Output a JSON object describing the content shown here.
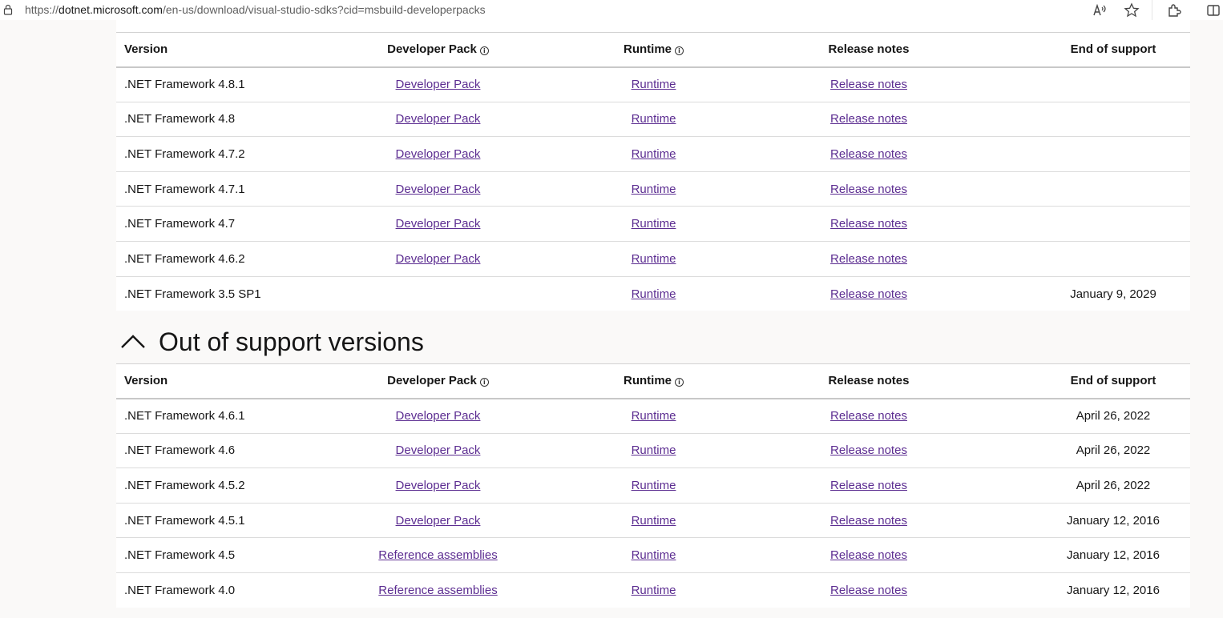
{
  "browser": {
    "url_scheme": "https://",
    "url_host": "dotnet.microsoft.com",
    "url_path": "/en-us/download/visual-studio-sdks?cid=msbuild-developerpacks"
  },
  "table_headers": {
    "version": "Version",
    "developer_pack": "Developer Pack",
    "runtime": "Runtime",
    "release_notes": "Release notes",
    "end_of_support": "End of support"
  },
  "supported": {
    "rows": [
      {
        "version": ".NET Framework 4.8.1",
        "pack": "Developer Pack",
        "runtime": "Runtime",
        "notes": "Release notes",
        "eos": ""
      },
      {
        "version": ".NET Framework 4.8",
        "pack": "Developer Pack",
        "runtime": "Runtime",
        "notes": "Release notes",
        "eos": ""
      },
      {
        "version": ".NET Framework 4.7.2",
        "pack": "Developer Pack",
        "runtime": "Runtime",
        "notes": "Release notes",
        "eos": ""
      },
      {
        "version": ".NET Framework 4.7.1",
        "pack": "Developer Pack",
        "runtime": "Runtime",
        "notes": "Release notes",
        "eos": ""
      },
      {
        "version": ".NET Framework 4.7",
        "pack": "Developer Pack",
        "runtime": "Runtime",
        "notes": "Release notes",
        "eos": ""
      },
      {
        "version": ".NET Framework 4.6.2",
        "pack": "Developer Pack",
        "runtime": "Runtime",
        "notes": "Release notes",
        "eos": ""
      },
      {
        "version": ".NET Framework 3.5 SP1",
        "pack": "",
        "runtime": "Runtime",
        "notes": "Release notes",
        "eos": "January 9, 2029"
      }
    ]
  },
  "out_of_support": {
    "title": "Out of support versions",
    "rows": [
      {
        "version": ".NET Framework 4.6.1",
        "pack": "Developer Pack",
        "runtime": "Runtime",
        "notes": "Release notes",
        "eos": "April 26, 2022"
      },
      {
        "version": ".NET Framework 4.6",
        "pack": "Developer Pack",
        "runtime": "Runtime",
        "notes": "Release notes",
        "eos": "April 26, 2022"
      },
      {
        "version": ".NET Framework 4.5.2",
        "pack": "Developer Pack",
        "runtime": "Runtime",
        "notes": "Release notes",
        "eos": "April 26, 2022"
      },
      {
        "version": ".NET Framework 4.5.1",
        "pack": "Developer Pack",
        "runtime": "Runtime",
        "notes": "Release notes",
        "eos": "January 12, 2016"
      },
      {
        "version": ".NET Framework 4.5",
        "pack": "Reference assemblies",
        "runtime": "Runtime",
        "notes": "Release notes",
        "eos": "January 12, 2016"
      },
      {
        "version": ".NET Framework 4.0",
        "pack": "Reference assemblies",
        "runtime": "Runtime",
        "notes": "Release notes",
        "eos": "January 12, 2016"
      }
    ]
  },
  "colors": {
    "link": "#5c2d91",
    "text": "#161616",
    "page_bg": "#faf9f8"
  }
}
